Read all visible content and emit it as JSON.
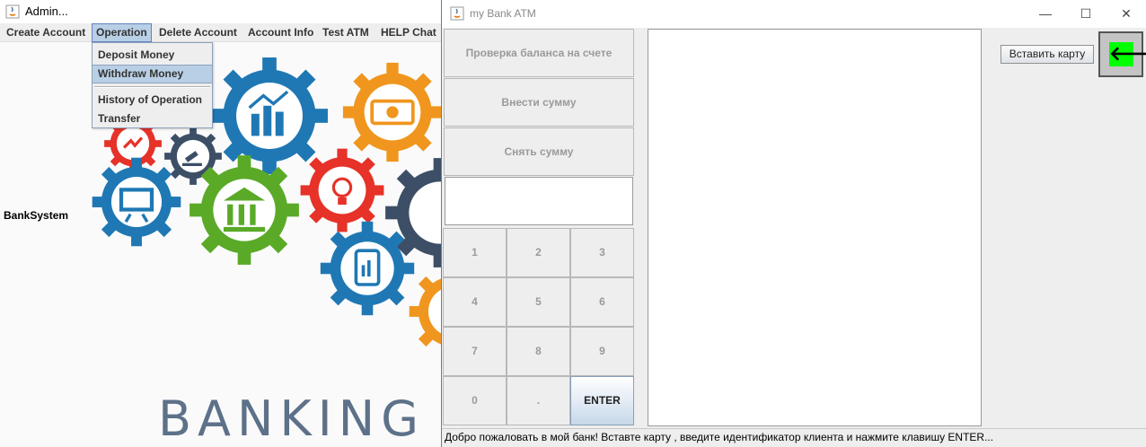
{
  "admin": {
    "title": "Admin...",
    "menu": [
      "Create Account",
      "Operation",
      "Delete Account",
      "Account Info",
      "Test ATM",
      "HELP Chat"
    ],
    "dropdown": [
      "Deposit Money",
      "Withdraw Money",
      "History of Operation",
      "Transfer"
    ],
    "bank_label": "BankSystem",
    "banner_text": "BANKING"
  },
  "atm": {
    "title": "my Bank ATM",
    "window_controls": {
      "minimize": "—",
      "maximize": "☐",
      "close": "✕"
    },
    "buttons": {
      "balance": "Проверка баланса на счете",
      "deposit": "Внести сумму",
      "withdraw": "Снять сумму"
    },
    "keypad": [
      "1",
      "2",
      "3",
      "4",
      "5",
      "6",
      "7",
      "8",
      "9",
      "0",
      ".",
      "ENTER"
    ],
    "insert_card": "Вставить карту",
    "back_arrow": "🡐",
    "status": "Добро пожаловать в мой банк! Вставте карту , введите идентификатор клиента и нажмите клавишу ENTER..."
  },
  "colors": {
    "menu_highlight": "#b8cfe5",
    "back_button_green": "#00ff00",
    "gear_blue": "#1f78b4",
    "gear_orange": "#f0961e",
    "gear_green": "#5aaa28",
    "gear_red": "#e63228",
    "gear_navy": "#3c4f66"
  }
}
